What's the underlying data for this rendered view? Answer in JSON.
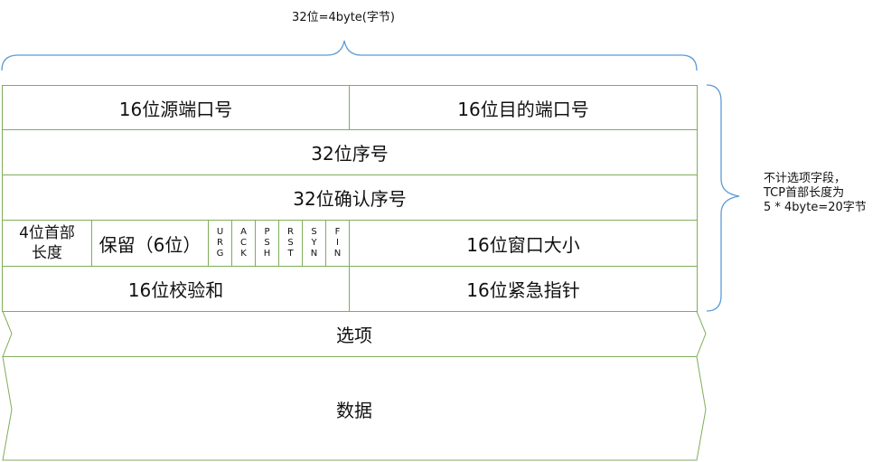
{
  "top_brace_label": "32位=4byte(字节)",
  "header_rows": {
    "src_port": "16位源端口号",
    "dst_port": "16位目的端口号",
    "seq": "32位序号",
    "ack_num": "32位确认序号",
    "header_len": "4位首部\n长度",
    "reserved": "保留（6位）",
    "flags": [
      "U\nR\nG",
      "A\nC\nK",
      "P\nS\nH",
      "R\nS\nT",
      "S\nY\nN",
      "F\nI\nN"
    ],
    "window": "16位窗口大小",
    "checksum": "16位校验和",
    "urgent": "16位紧急指针"
  },
  "options": "选项",
  "data": "数据",
  "side_note": "不计选项字段，\nTCP首部长度为\n5 * 4byte=20字节",
  "colors": {
    "border": "#7fae5a",
    "brace": "#5b9bd5"
  }
}
